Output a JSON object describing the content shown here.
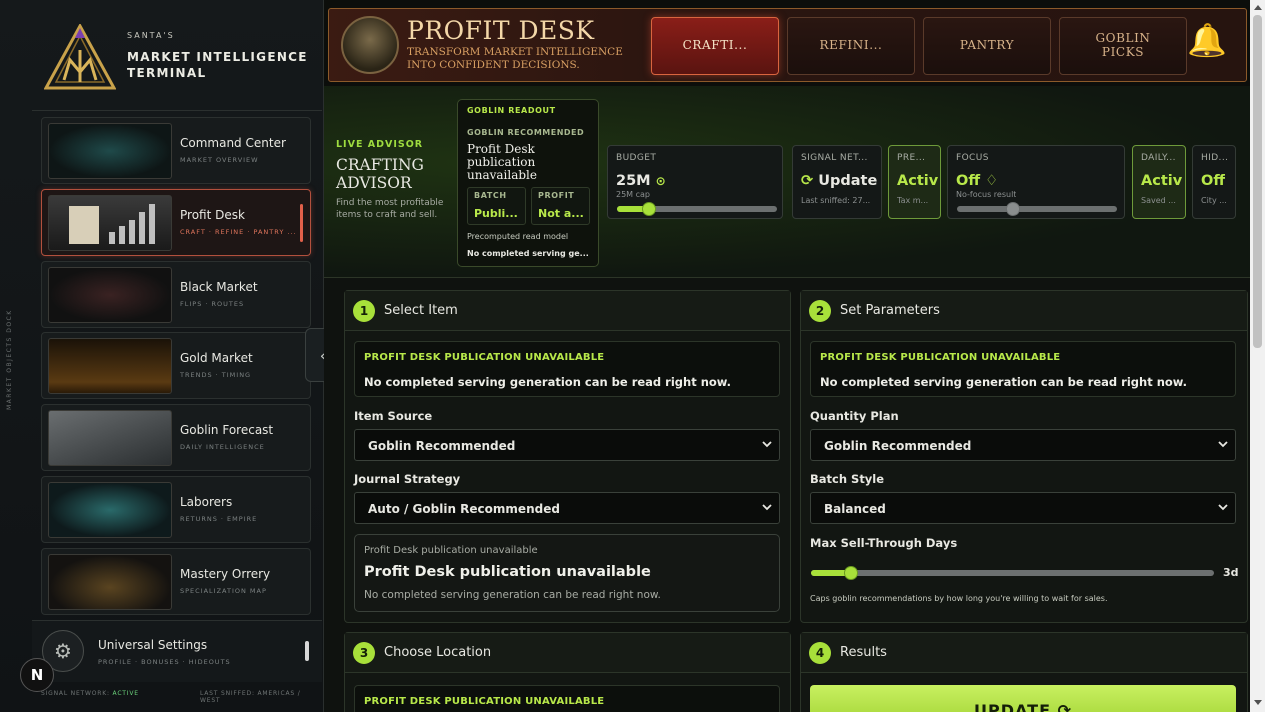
{
  "sidebar": {
    "dock_label": "MARKET OBJECTS DOCK",
    "brand": {
      "small": "SANTA'S",
      "line1": "MARKET INTELLIGENCE",
      "line2": "TERMINAL"
    },
    "items": [
      {
        "label": "Command Center",
        "sub": "MARKET OVERVIEW",
        "active": false
      },
      {
        "label": "Profit Desk",
        "sub": "CRAFT · REFINE · PANTRY ...",
        "active": true
      },
      {
        "label": "Black Market",
        "sub": "FLIPS · ROUTES",
        "active": false
      },
      {
        "label": "Gold Market",
        "sub": "TRENDS · TIMING",
        "active": false
      },
      {
        "label": "Goblin Forecast",
        "sub": "DAILY INTELLIGENCE",
        "active": false
      },
      {
        "label": "Laborers",
        "sub": "RETURNS · EMPIRE",
        "active": false
      },
      {
        "label": "Mastery Orrery",
        "sub": "SPECIALIZATION MAP",
        "active": false
      }
    ],
    "settings": {
      "title": "Universal Settings",
      "sub": "PROFILE · BONUSES · HIDEOUTS"
    },
    "status": {
      "left_label": "SIGNAL NETWORK:",
      "left_value": "ACTIVE",
      "right": "LAST SNIFFED: AMERICAS / WEST"
    },
    "n_badge": "N",
    "collapse_icon": "‹"
  },
  "header": {
    "title": "PROFIT DESK",
    "subtitle1": "TRANSFORM MARKET INTELLIGENCE",
    "subtitle2": "INTO CONFIDENT DECISIONS.",
    "tabs": [
      {
        "label": "CRAFTI...",
        "active": true
      },
      {
        "label": "REFINI...",
        "active": false
      },
      {
        "label": "PANTRY",
        "active": false
      },
      {
        "label": "GOBLIN\nPICKS",
        "active": false
      }
    ],
    "bell_icon": "bell-icon"
  },
  "advisor": {
    "tag": "LIVE ADVISOR",
    "title1": "CRAFTING",
    "title2": "ADVISOR",
    "desc": "Find the most profitable items to craft and sell.",
    "readout": {
      "head": "GOBLIN READOUT",
      "rec_label": "GOBLIN RECOMMENDED",
      "value": "Profit Desk publication unavailable",
      "batch_label": "BATCH",
      "batch_value": "Publi...",
      "profit_label": "PROFIT",
      "profit_value": "Not a...",
      "pre": "Precomputed read model",
      "none": "No completed serving ge..."
    },
    "cards": {
      "budget": {
        "label": "BUDGET",
        "value": "25M",
        "sub": "25M cap",
        "level": 0.2
      },
      "signal": {
        "label": "SIGNAL NET...",
        "value": "Update",
        "sub": "Last sniffed: 27..."
      },
      "premium": {
        "label": "PRE...",
        "value": "Activ",
        "sub": "Tax m..."
      },
      "focus": {
        "label": "FOCUS",
        "value": "Off",
        "sub": "No-focus result",
        "level": 0.35
      },
      "daily": {
        "label": "DAILY...",
        "value": "Activ",
        "sub": "Saved ..."
      },
      "hideout": {
        "label": "HID...",
        "value": "Off",
        "sub": "City ..."
      }
    }
  },
  "panels": {
    "select_item": {
      "num": "1",
      "title": "Select Item",
      "alert_title": "PROFIT DESK PUBLICATION UNAVAILABLE",
      "alert_text": "No completed serving generation can be read right now.",
      "source_label": "Item Source",
      "source_value": "Goblin Recommended",
      "journal_label": "Journal Strategy",
      "journal_value": "Auto / Goblin Recommended",
      "pub_label": "Profit Desk publication unavailable",
      "pub_title": "Profit Desk publication unavailable",
      "pub_sub": "No completed serving generation can be read right now."
    },
    "set_params": {
      "num": "2",
      "title": "Set Parameters",
      "alert_title": "PROFIT DESK PUBLICATION UNAVAILABLE",
      "alert_text": "No completed serving generation can be read right now.",
      "qty_label": "Quantity Plan",
      "qty_value": "Goblin Recommended",
      "batch_label": "Batch Style",
      "batch_value": "Balanced",
      "sell_label": "Max Sell-Through Days",
      "sell_value": "3d",
      "sell_level": 0.1,
      "sell_caption": "Caps goblin recommendations by how long you're willing to wait for sales."
    },
    "location": {
      "num": "3",
      "title": "Choose Location",
      "alert_title": "PROFIT DESK PUBLICATION UNAVAILABLE"
    },
    "results": {
      "num": "4",
      "title": "Results",
      "button": "UPDATE"
    }
  }
}
